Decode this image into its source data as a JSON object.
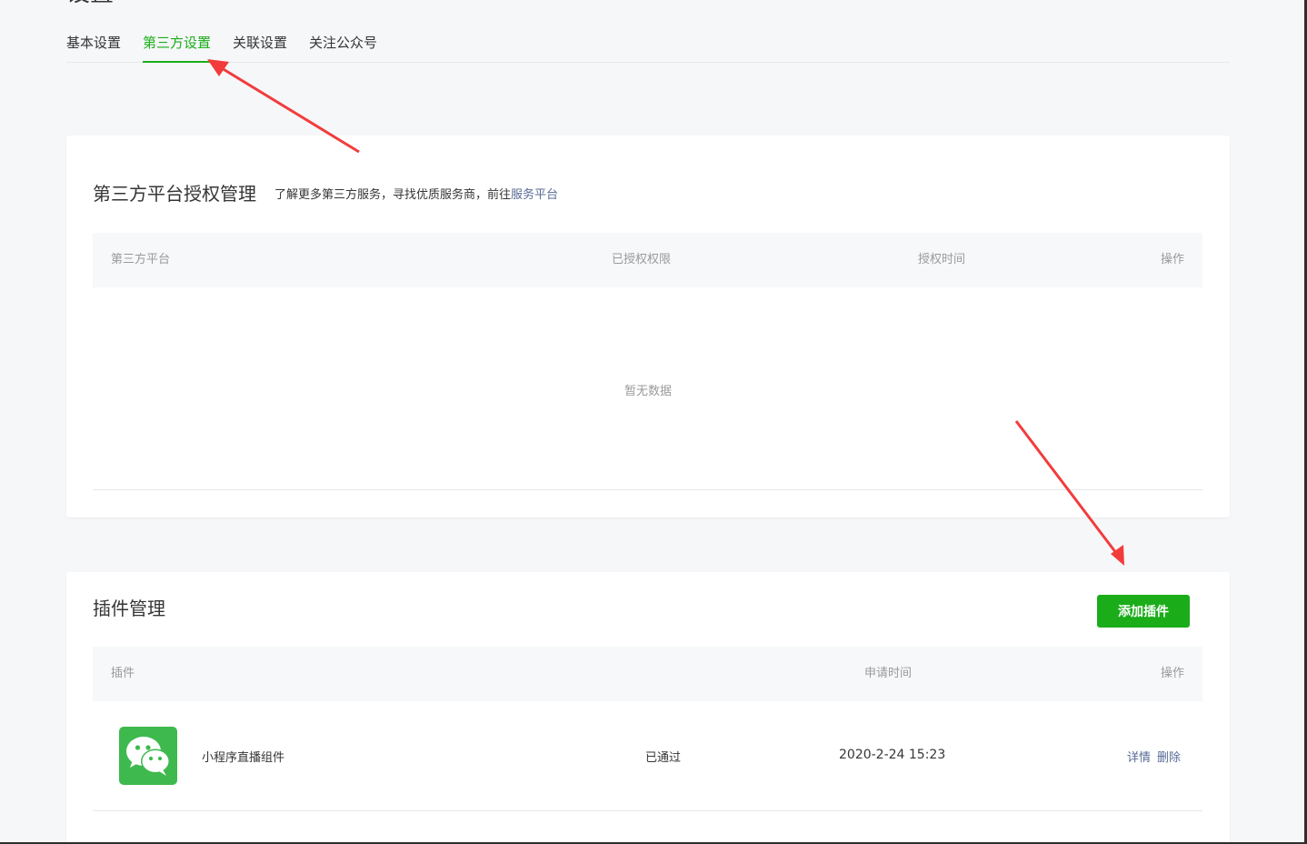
{
  "page": {
    "title": "设置"
  },
  "tabs": [
    {
      "label": "基本设置"
    },
    {
      "label": "第三方设置",
      "active": true
    },
    {
      "label": "关联设置"
    },
    {
      "label": "关注公众号"
    }
  ],
  "auth_section": {
    "title": "第三方平台授权管理",
    "desc_text": "了解更多第三方服务，寻找优质服务商，前往",
    "desc_link": "服务平台",
    "columns": [
      "第三方平台",
      "已授权权限",
      "授权时间",
      "操作"
    ],
    "empty_text": "暂无数据"
  },
  "plugin_section": {
    "title": "插件管理",
    "add_button": "添加插件",
    "columns": [
      "插件",
      "申请时间",
      "操作"
    ],
    "rows": [
      {
        "name": "小程序直播组件",
        "status": "已通过",
        "time": "2020-2-24 15:23",
        "detail": "详情",
        "delete": "删除",
        "icon": "wechat-icon"
      }
    ]
  },
  "colors": {
    "accent": "#1aad19",
    "link": "#576b95",
    "annotation": "#f23c3c"
  }
}
